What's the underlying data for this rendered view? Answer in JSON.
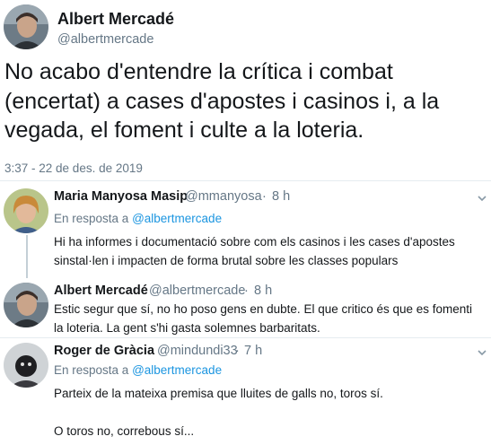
{
  "main_tweet": {
    "author_name": "Albert Mercadé",
    "author_handle": "@albertmercade",
    "text": "No acabo d'entendre la crítica i combat (encertat) a cases d'apostes i casinos i, a la vegada, el foment i culte a la loteria.",
    "timestamp": "3:37 - 22 de des. de 2019"
  },
  "replies": [
    {
      "name": "Maria Manyosa Masip",
      "handle": "@mmanyosa",
      "age": "8 h",
      "reply_prefix": "En resposta a",
      "reply_to": "@albertmercade",
      "text": "Hi ha informes i documentació sobre com els casinos i les cases d'apostes sinstal·len i impacten de forma brutal sobre les classes populars"
    },
    {
      "name": "Albert Mercadé",
      "handle": "@albertmercade",
      "age": "8 h",
      "text": "Estic segur que sí, no ho poso gens en dubte. El que critico és que es fomenti la loteria. La gent s'hi gasta solemnes barbaritats."
    },
    {
      "name": "Roger de Gràcia",
      "handle": "@mindundi33",
      "age": "7 h",
      "reply_prefix": "En resposta a",
      "reply_to": "@albertmercade",
      "text": "Parteix de la mateixa premisa que lluites de galls no, toros sí.",
      "text2": "O toros no, correbous sí..."
    }
  ],
  "separator": "·",
  "colors": {
    "link": "#1b95e0",
    "muted": "#657786",
    "text": "#14171a",
    "thread": "#c4cfd6"
  }
}
